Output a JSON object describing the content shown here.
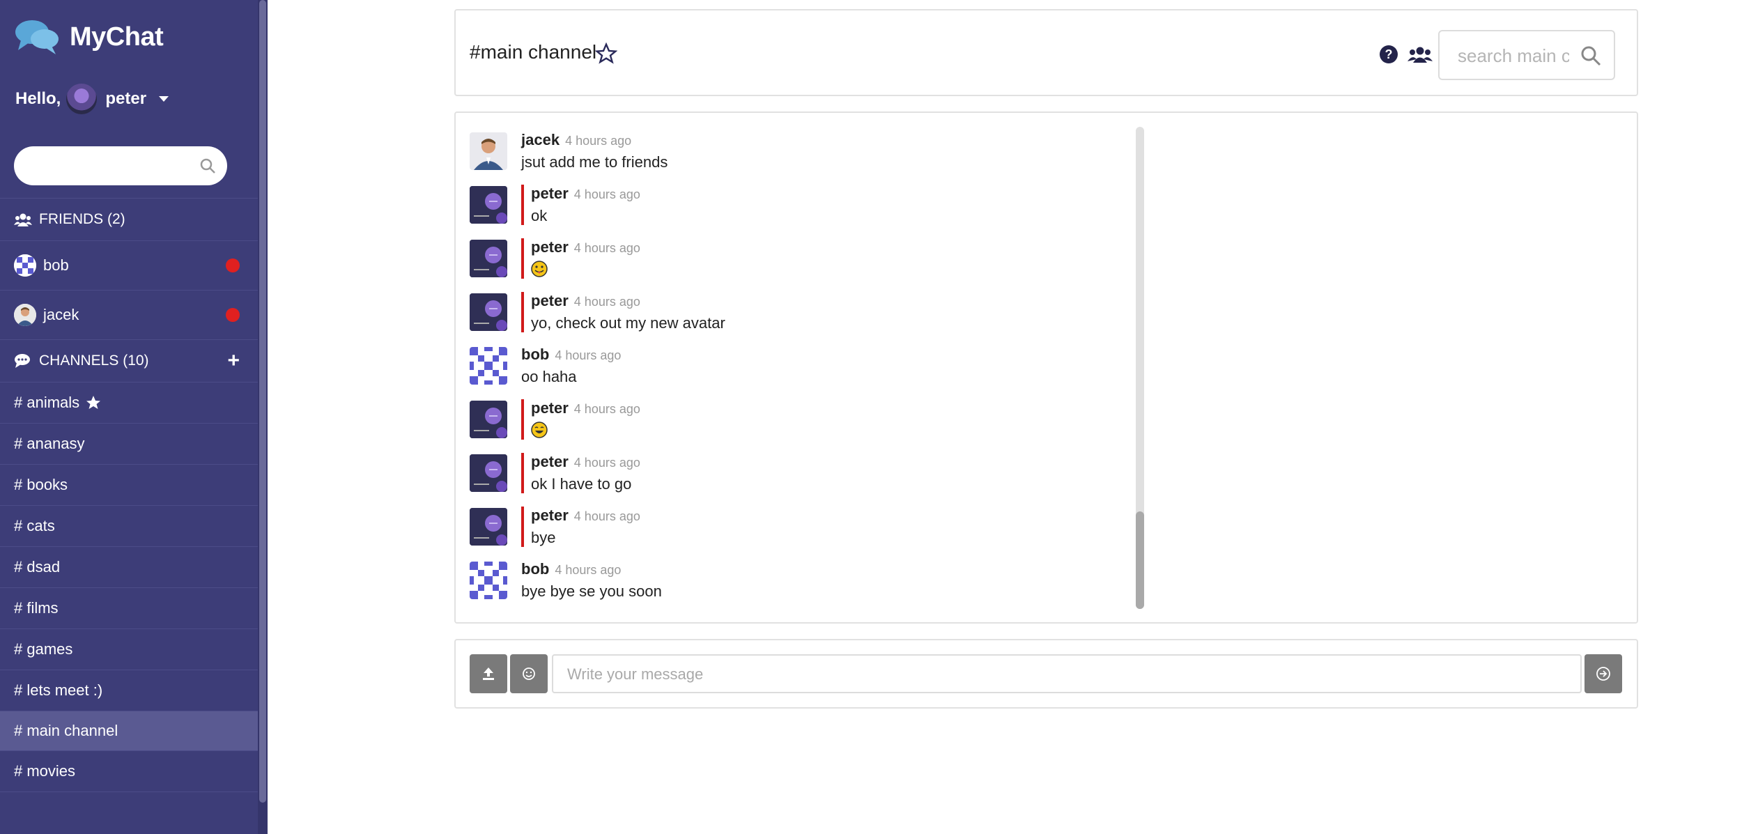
{
  "app": {
    "name": "MyChat"
  },
  "user": {
    "greeting": "Hello,",
    "name": "peter"
  },
  "sidebar": {
    "search_placeholder": "",
    "friends_header": "FRIENDS (2)",
    "friends": [
      {
        "name": "bob",
        "online_status_color": "#e02020"
      },
      {
        "name": "jacek",
        "online_status_color": "#e02020"
      }
    ],
    "channels_header": "CHANNELS (10)",
    "channels": [
      {
        "name": "# animals",
        "favorite": true
      },
      {
        "name": "# ananasy"
      },
      {
        "name": "# books"
      },
      {
        "name": "# cats"
      },
      {
        "name": "# dsad"
      },
      {
        "name": "# films"
      },
      {
        "name": "# games"
      },
      {
        "name": "# lets meet :)"
      },
      {
        "name": "# main channel",
        "active": true
      },
      {
        "name": "# movies"
      }
    ]
  },
  "channel": {
    "title": "#main channel",
    "search_placeholder": "search main channel"
  },
  "messages": [
    {
      "author": "jacek",
      "time": "4 hours ago",
      "body": "jsut add me to friends"
    },
    {
      "author": "peter",
      "time": "4 hours ago",
      "body": "ok"
    },
    {
      "author": "peter",
      "time": "4 hours ago",
      "body": "",
      "emoji": "grinning-face-with-tongue"
    },
    {
      "author": "peter",
      "time": "4 hours ago",
      "body": "yo, check out my new avatar"
    },
    {
      "author": "bob",
      "time": "4 hours ago",
      "body": "oo haha"
    },
    {
      "author": "peter",
      "time": "4 hours ago",
      "body": "",
      "emoji": "laughing-face"
    },
    {
      "author": "peter",
      "time": "4 hours ago",
      "body": "ok I have to go"
    },
    {
      "author": "peter",
      "time": "4 hours ago",
      "body": "bye"
    },
    {
      "author": "bob",
      "time": "4 hours ago",
      "body": "bye bye se you soon"
    }
  ],
  "composer": {
    "placeholder": "Write your message"
  },
  "colors": {
    "sidebar_bg": "#3d3d78",
    "active_item": "#5a5a92",
    "reply_bar": "#d11a1a",
    "button_gray": "#7a7a7a"
  }
}
